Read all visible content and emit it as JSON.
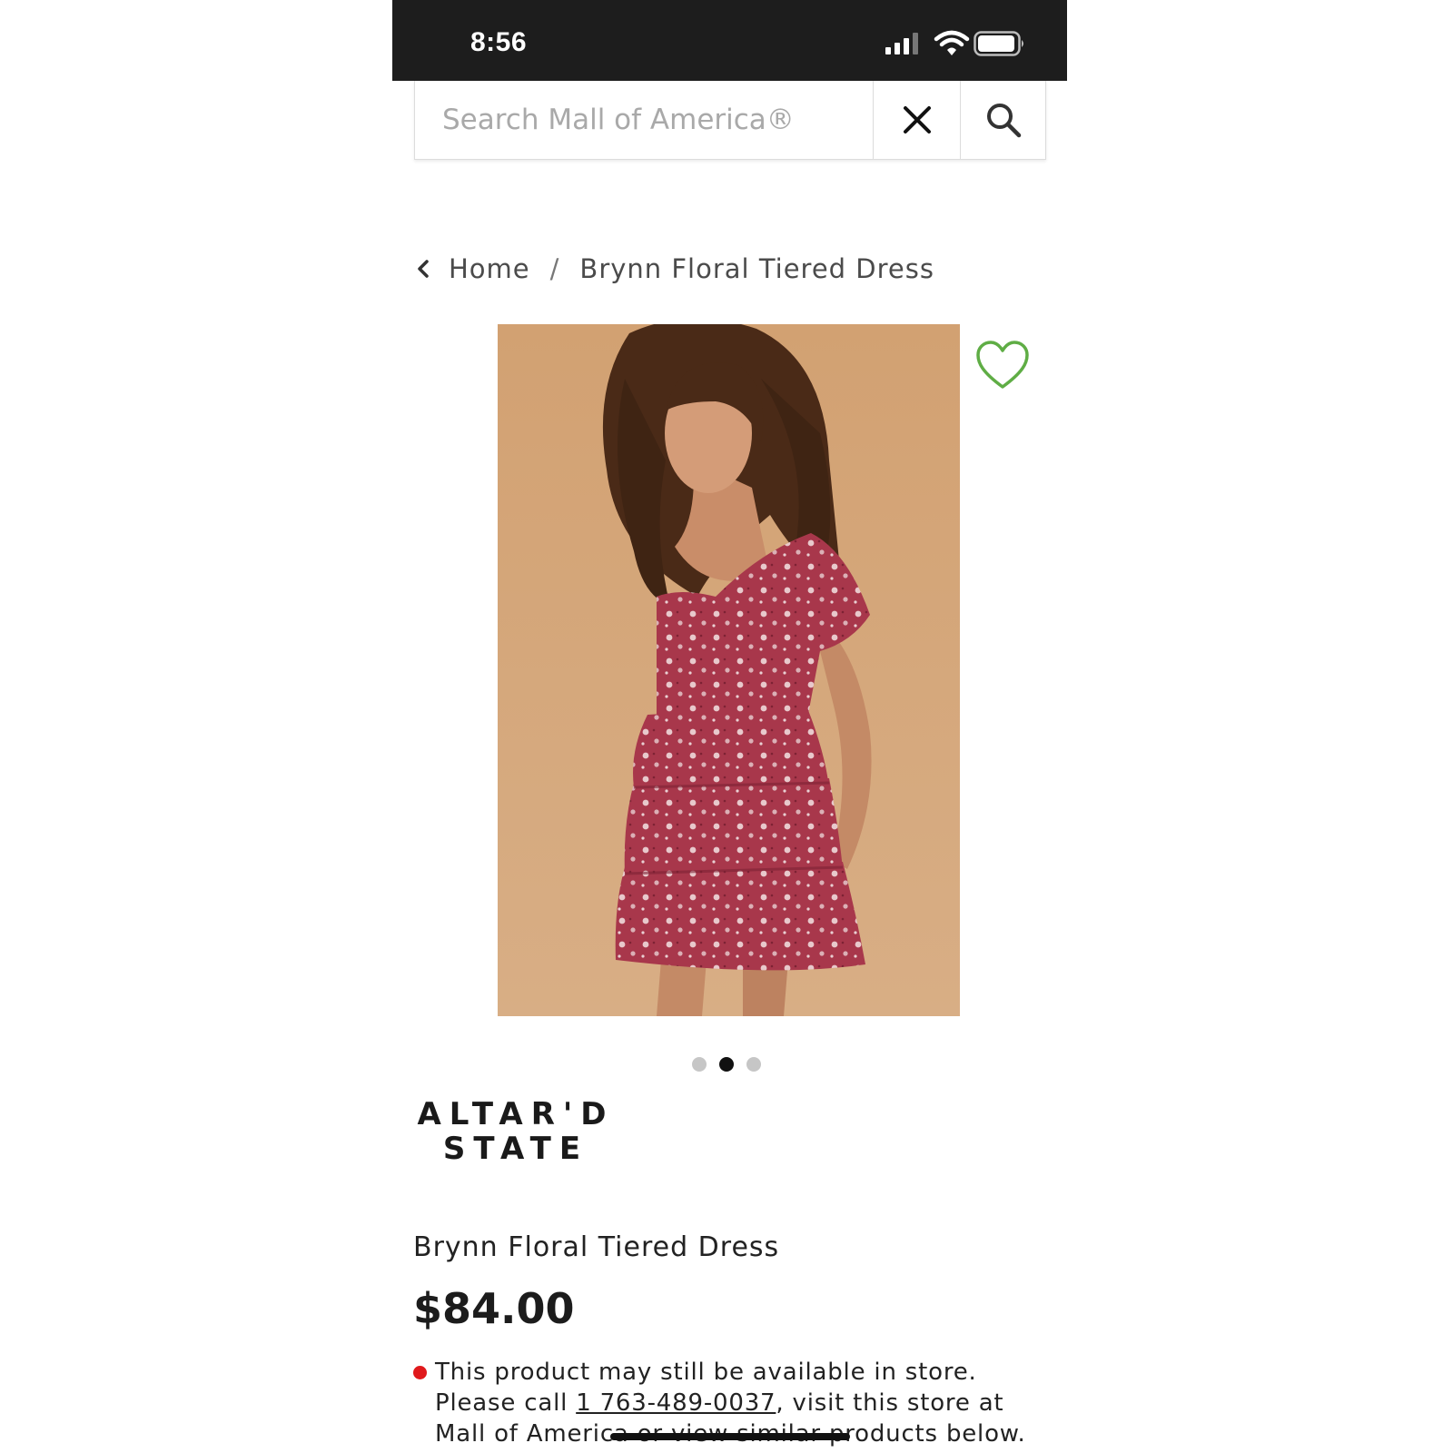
{
  "status_bar": {
    "time": "8:56"
  },
  "search": {
    "placeholder": "Search Mall of America®",
    "value": ""
  },
  "breadcrumb": {
    "home": "Home",
    "separator": "/",
    "current": "Brynn Floral Tiered Dress"
  },
  "product": {
    "image_count": 3,
    "active_image_index": 1,
    "brand_line1": "ALTAR'D",
    "brand_line2": "STATE",
    "name": "Brynn Floral Tiered Dress",
    "price": "$84.00",
    "availability_part1": "This product may still be available in store. Please call ",
    "phone": "1 763-489-0037",
    "availability_part2": ", visit this store at Mall of America or view similar products below."
  },
  "colors": {
    "status_bg": "#1d1d1d",
    "wishlist_heart": "#5fad45",
    "unavailable_dot": "#e0191c",
    "image_bg": "#d7aa7d",
    "dress": "#a8374b"
  },
  "icons": [
    "signal-icon",
    "wifi-icon",
    "battery-icon",
    "close-icon",
    "search-icon",
    "chevron-left-icon",
    "heart-icon"
  ]
}
